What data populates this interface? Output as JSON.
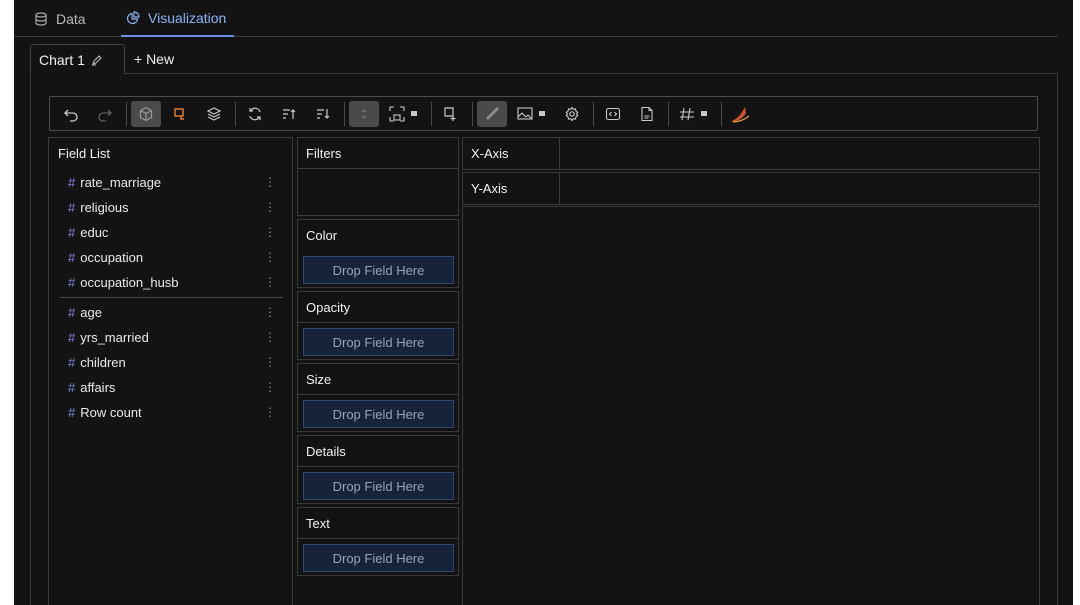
{
  "nav": {
    "tabs": [
      {
        "label": "Data",
        "icon": "database-icon",
        "active": false
      },
      {
        "label": "Visualization",
        "icon": "chart-pie-icon",
        "active": true
      }
    ]
  },
  "chart_tabs": {
    "items": [
      {
        "label": "Chart 1",
        "icon": "edit-icon",
        "active": true
      },
      {
        "label": "+ New",
        "active": false
      }
    ]
  },
  "toolbar": {
    "buttons": [
      "undo-icon",
      "redo-icon",
      "cube-icon",
      "lasso-icon",
      "layers-icon",
      "refresh-icon",
      "sort-ascending-icon",
      "sort-descending-icon",
      "stack-toggle-icon",
      "fit-size-icon",
      "zoom-box-icon",
      "brush-icon",
      "image-export-icon",
      "settings-icon",
      "code-icon",
      "export-file-icon",
      "number-format-icon",
      "logo-icon"
    ],
    "accent_color": "#e07a2f"
  },
  "field_list": {
    "title": "Field List",
    "dimensions": [
      {
        "name": "rate_marriage"
      },
      {
        "name": "religious"
      },
      {
        "name": "educ"
      },
      {
        "name": "occupation"
      },
      {
        "name": "occupation_husb"
      }
    ],
    "measures": [
      {
        "name": "age"
      },
      {
        "name": "yrs_married"
      },
      {
        "name": "children"
      },
      {
        "name": "affairs"
      },
      {
        "name": "Row count"
      }
    ],
    "type_symbol": "#",
    "menu_symbol": "⋮"
  },
  "encodings": {
    "filters": {
      "label": "Filters"
    },
    "color": {
      "label": "Color",
      "drop": "Drop Field Here"
    },
    "opacity": {
      "label": "Opacity",
      "drop": "Drop Field Here"
    },
    "size": {
      "label": "Size",
      "drop": "Drop Field Here"
    },
    "details": {
      "label": "Details",
      "drop": "Drop Field Here"
    },
    "text": {
      "label": "Text",
      "drop": "Drop Field Here"
    }
  },
  "axes": {
    "x": {
      "label": "X-Axis"
    },
    "y": {
      "label": "Y-Axis"
    }
  },
  "colors": {
    "background": "#131314",
    "accent_blue": "#8ab4f8",
    "drop_bg": "#17233a",
    "field_hash": "#7c8ae0"
  }
}
